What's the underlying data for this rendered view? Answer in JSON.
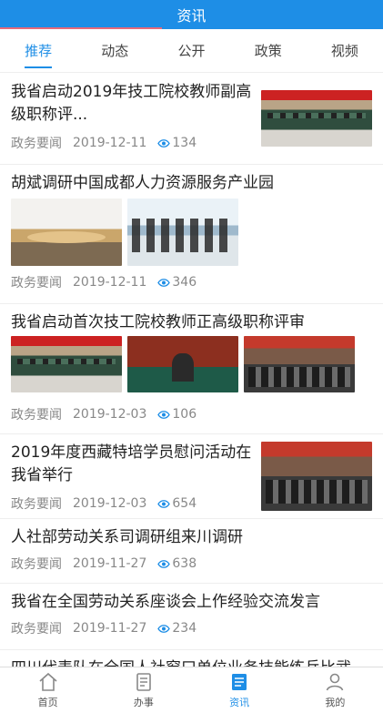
{
  "header": {
    "title": "资讯"
  },
  "tabs": [
    {
      "label": "推荐",
      "active": true
    },
    {
      "label": "动态",
      "active": false
    },
    {
      "label": "公开",
      "active": false
    },
    {
      "label": "政策",
      "active": false
    },
    {
      "label": "视频",
      "active": false
    }
  ],
  "articles": [
    {
      "title": "我省启动2019年技工院校教师副高级职称评...",
      "source": "政务要闻",
      "date": "2019-12-11",
      "views": "134"
    },
    {
      "title": "胡斌调研中国成都人力资源服务产业园",
      "source": "政务要闻",
      "date": "2019-12-11",
      "views": "346"
    },
    {
      "title": "我省启动首次技工院校教师正高级职称评审",
      "source": "政务要闻",
      "date": "2019-12-03",
      "views": "106"
    },
    {
      "title": "2019年度西藏特培学员慰问活动在我省举行",
      "source": "政务要闻",
      "date": "2019-12-03",
      "views": "654"
    },
    {
      "title": "人社部劳动关系司调研组来川调研",
      "source": "政务要闻",
      "date": "2019-11-27",
      "views": "638"
    },
    {
      "title": "我省在全国劳动关系座谈会上作经验交流发言",
      "source": "政务要闻",
      "date": "2019-11-27",
      "views": "234"
    },
    {
      "title": "四川代表队在全国人社窗口单位业务技能练兵比武"
    }
  ],
  "tabbar": [
    {
      "label": "首页",
      "icon": "home-icon",
      "active": false
    },
    {
      "label": "办事",
      "icon": "task-icon",
      "active": false
    },
    {
      "label": "资讯",
      "icon": "news-icon",
      "active": true
    },
    {
      "label": "我的",
      "icon": "user-icon",
      "active": false
    }
  ],
  "colors": {
    "primary": "#1e8ee6",
    "text": "#222222",
    "meta": "#888888"
  }
}
